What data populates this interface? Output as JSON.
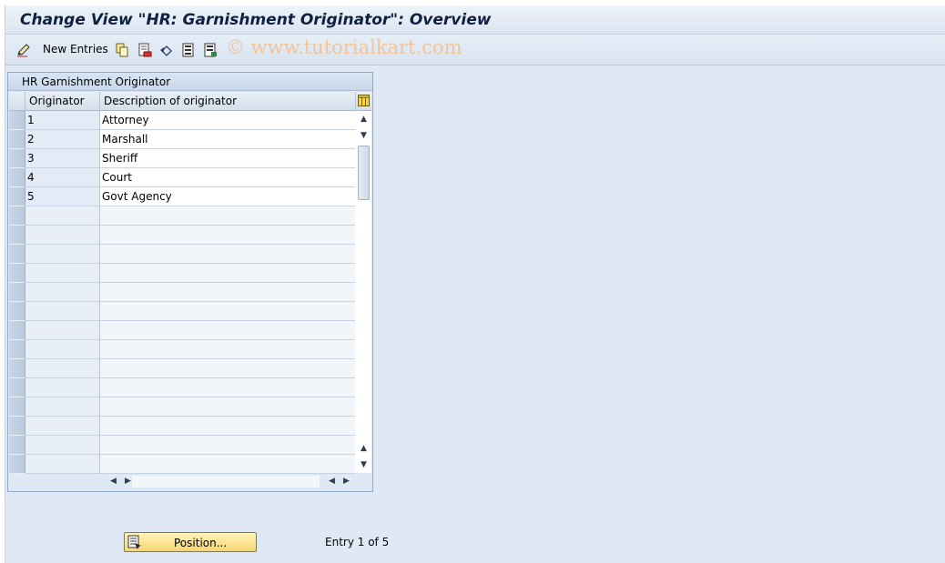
{
  "window": {
    "title": "Change View \"HR: Garnishment Originator\": Overview"
  },
  "toolbar": {
    "new_entries_label": "New Entries",
    "icons": [
      "edit-pencil-icon",
      "copy-icon",
      "delete-icon",
      "undo-icon",
      "select-all-icon",
      "deselect-all-icon"
    ],
    "watermark": "© www.tutorialkart.com"
  },
  "table": {
    "title": "HR Garnishment Originator",
    "columns": [
      "Originator",
      "Description of originator"
    ],
    "rows": [
      {
        "originator": "1",
        "description": "Attorney"
      },
      {
        "originator": "2",
        "description": "Marshall"
      },
      {
        "originator": "3",
        "description": "Sheriff"
      },
      {
        "originator": "4",
        "description": "Court"
      },
      {
        "originator": "5",
        "description": "Govt Agency"
      }
    ],
    "empty_row_count": 14
  },
  "footer": {
    "position_button_label": "Position...",
    "entry_info": "Entry 1 of 5"
  },
  "colors": {
    "background": "#dfe9f5",
    "title_text": "#102040",
    "position_button": "#f7d774"
  }
}
